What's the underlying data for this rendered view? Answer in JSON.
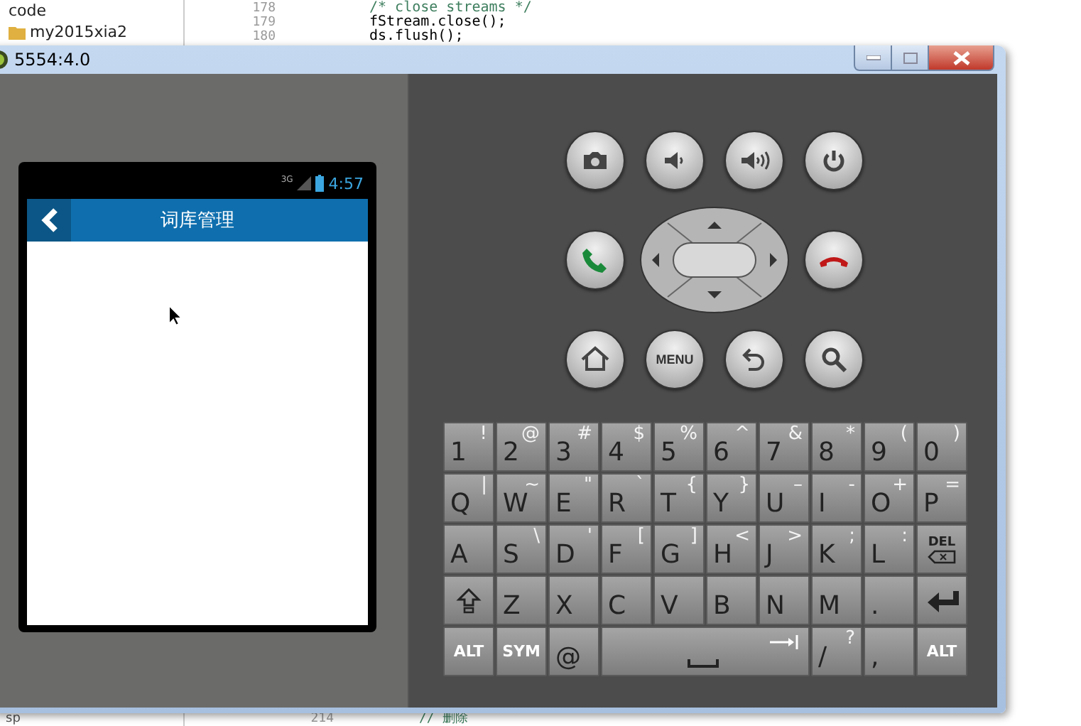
{
  "background_editor": {
    "project_items": [
      {
        "label": "code",
        "kind": "text"
      },
      {
        "label": "my2015xia2",
        "kind": "folder"
      }
    ],
    "code_lines": [
      {
        "number": "178",
        "text": "/* close streams */",
        "kind": "comment"
      },
      {
        "number": "179",
        "text": "fStream.close();",
        "kind": "code"
      },
      {
        "number": "180",
        "text": "ds.flush();",
        "kind": "code"
      }
    ],
    "bottom": {
      "project_item": "sp",
      "line_number": "214",
      "code": "// 删除"
    }
  },
  "emulator": {
    "title": "5554:4.0",
    "phone": {
      "status_bar": {
        "network": "3G",
        "time": "4:57"
      },
      "action_bar": {
        "title": "词库管理"
      }
    },
    "hardware_buttons": [
      {
        "kind": "camera"
      },
      {
        "kind": "volume-down"
      },
      {
        "kind": "volume-up"
      },
      {
        "kind": "power"
      },
      {
        "kind": "call"
      },
      {
        "kind": "dpad"
      },
      {
        "kind": "hang-up"
      },
      {
        "kind": "home"
      },
      {
        "kind": "menu",
        "label": "MENU"
      },
      {
        "kind": "back"
      },
      {
        "kind": "search"
      }
    ],
    "keyboard": {
      "rows": [
        [
          {
            "kind": "char",
            "main": "1",
            "alt": "!"
          },
          {
            "kind": "char",
            "main": "2",
            "alt": "@"
          },
          {
            "kind": "char",
            "main": "3",
            "alt": "#"
          },
          {
            "kind": "char",
            "main": "4",
            "alt": "$"
          },
          {
            "kind": "char",
            "main": "5",
            "alt": "%"
          },
          {
            "kind": "char",
            "main": "6",
            "alt": "^"
          },
          {
            "kind": "char",
            "main": "7",
            "alt": "&"
          },
          {
            "kind": "char",
            "main": "8",
            "alt": "*"
          },
          {
            "kind": "char",
            "main": "9",
            "alt": "("
          },
          {
            "kind": "char",
            "main": "0",
            "alt": ")"
          }
        ],
        [
          {
            "kind": "char",
            "main": "Q",
            "alt": "|"
          },
          {
            "kind": "char",
            "main": "W",
            "alt": "~"
          },
          {
            "kind": "char",
            "main": "E",
            "alt": "\""
          },
          {
            "kind": "char",
            "main": "R",
            "alt": "`"
          },
          {
            "kind": "char",
            "main": "T",
            "alt": "{"
          },
          {
            "kind": "char",
            "main": "Y",
            "alt": "}"
          },
          {
            "kind": "char",
            "main": "U",
            "alt": "–"
          },
          {
            "kind": "char",
            "main": "I",
            "alt": "-"
          },
          {
            "kind": "char",
            "main": "O",
            "alt": "+"
          },
          {
            "kind": "char",
            "main": "P",
            "alt": "="
          }
        ],
        [
          {
            "kind": "char",
            "main": "A"
          },
          {
            "kind": "char",
            "main": "S",
            "alt": "\\"
          },
          {
            "kind": "char",
            "main": "D",
            "alt": "'"
          },
          {
            "kind": "char",
            "main": "F",
            "alt": "["
          },
          {
            "kind": "char",
            "main": "G",
            "alt": "]"
          },
          {
            "kind": "char",
            "main": "H",
            "alt": "<"
          },
          {
            "kind": "char",
            "main": "J",
            "alt": ">"
          },
          {
            "kind": "char",
            "main": "K",
            "alt": ";"
          },
          {
            "kind": "char",
            "main": "L",
            "alt": ":"
          },
          {
            "kind": "del",
            "label": "DEL"
          }
        ],
        [
          {
            "kind": "shift"
          },
          {
            "kind": "char",
            "main": "Z"
          },
          {
            "kind": "char",
            "main": "X"
          },
          {
            "kind": "char",
            "main": "C"
          },
          {
            "kind": "char",
            "main": "V"
          },
          {
            "kind": "char",
            "main": "B"
          },
          {
            "kind": "char",
            "main": "N"
          },
          {
            "kind": "char",
            "main": "M"
          },
          {
            "kind": "char",
            "main": "."
          },
          {
            "kind": "enter"
          }
        ]
      ],
      "bottom_row": [
        {
          "kind": "text",
          "label": "ALT"
        },
        {
          "kind": "text",
          "label": "SYM"
        },
        {
          "kind": "char",
          "main": "@"
        },
        {
          "kind": "space"
        },
        {
          "kind": "char",
          "main": "/",
          "alt": "?"
        },
        {
          "kind": "char",
          "main": ","
        },
        {
          "kind": "text",
          "label": "ALT"
        }
      ]
    }
  }
}
